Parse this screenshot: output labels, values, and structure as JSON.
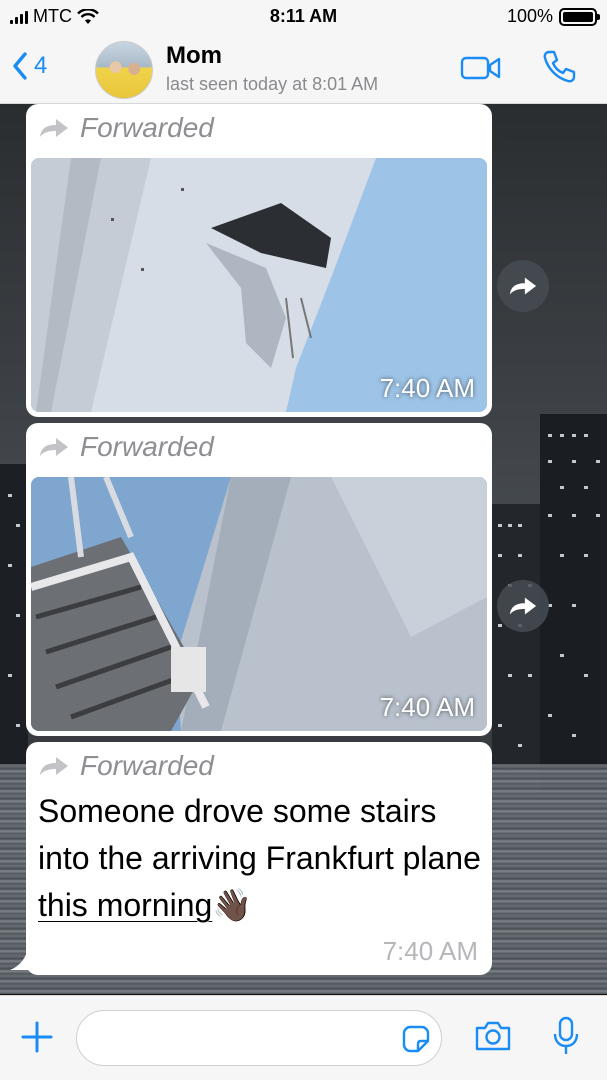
{
  "status_bar": {
    "carrier": "MTC",
    "time": "8:11 AM",
    "battery": "100%",
    "battery_level": 1.0
  },
  "header": {
    "back_count": "4",
    "contact_name": "Mom",
    "last_seen": "last seen today at 8:01 AM"
  },
  "messages": [
    {
      "forwarded_label": "Forwarded",
      "type": "image",
      "time": "7:40 AM"
    },
    {
      "forwarded_label": "Forwarded",
      "type": "image",
      "time": "7:40 AM"
    },
    {
      "forwarded_label": "Forwarded",
      "type": "text",
      "text_main": "Someone drove some stairs into the arriving Frankfurt plane ",
      "text_underlined": "this morning",
      "emoji": "👋🏿",
      "time": "7:40 AM"
    }
  ],
  "colors": {
    "accent": "#1a8cf3",
    "bubble": "#ffffff",
    "bar": "#f6f6f6",
    "forwarded_text": "#8e8e93"
  },
  "icons": [
    "signal-icon",
    "wifi-icon",
    "battery-icon",
    "back-chevron-icon",
    "video-call-icon",
    "phone-icon",
    "forward-arrow-icon",
    "share-icon",
    "plus-icon",
    "sticker-icon",
    "camera-icon",
    "microphone-icon"
  ]
}
